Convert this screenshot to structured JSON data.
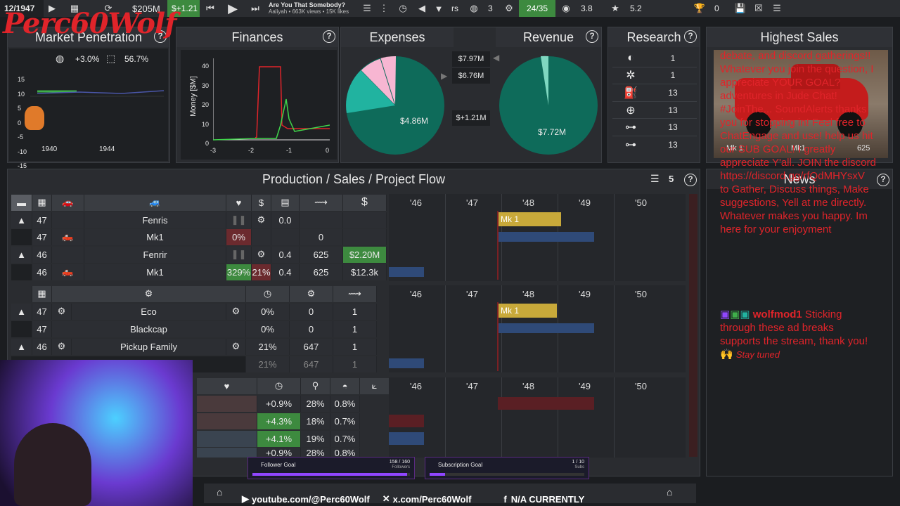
{
  "topbar": {
    "date": "12/1947",
    "money": "$205M",
    "delta": "$+1.21",
    "song_title": "Are You That Somebody?",
    "song_meta": "Aaliyah • 663K views • 15K likes",
    "rs_label": "rs",
    "regions": "3",
    "factories": "24/35",
    "rating": "3.8",
    "stars": "5.2",
    "trophies": "0"
  },
  "market": {
    "title": "Market Penetration",
    "global_pct": "+3.0%",
    "share_pct": "56.7%",
    "y_ticks": [
      "15",
      "10",
      "5",
      "0",
      "-5",
      "-10",
      "-15"
    ],
    "x_ticks": [
      "1940",
      "1944"
    ]
  },
  "finances": {
    "title": "Finances",
    "ylabel": "Money [$M]",
    "y_ticks": [
      "40",
      "30",
      "20",
      "10",
      "0"
    ],
    "x_ticks": [
      "-3",
      "-2",
      "-1",
      "0"
    ]
  },
  "expenses": {
    "title": "Expenses",
    "center_value": "$4.86M",
    "btn1": "$7.97M",
    "btn2": "$6.76M",
    "btn3": "$+1.21M"
  },
  "revenue": {
    "title": "Revenue",
    "center_value": "$7.72M"
  },
  "research": {
    "title": "Research",
    "rows": [
      {
        "icon": "turbo-icon",
        "value": "1"
      },
      {
        "icon": "wheel-icon",
        "value": "1"
      },
      {
        "icon": "fuel-icon",
        "value": "13"
      },
      {
        "icon": "steering-icon",
        "value": "13"
      },
      {
        "icon": "suspension-icon",
        "value": "13"
      },
      {
        "icon": "axle-icon",
        "value": "13"
      }
    ]
  },
  "highest_sales": {
    "title": "Highest Sales",
    "car1": "Mk 1",
    "car2": "Mk1",
    "value": "625"
  },
  "production": {
    "title": "Production / Sales / Project Flow",
    "count": "5",
    "years": [
      "'46",
      "'47",
      "'48",
      "'49",
      "'50"
    ],
    "rows1": [
      {
        "idx": "47",
        "name": "Fenris",
        "v1": "0.0",
        "sub": false
      },
      {
        "idx": "47",
        "name": "Mk1",
        "pct": "0%",
        "v2": "0",
        "sub": true
      },
      {
        "idx": "46",
        "name": "Fenrir",
        "v1": "0.4",
        "v2": "625",
        "money": "$2.20M",
        "sub": false
      },
      {
        "idx": "46",
        "name": "Mk1",
        "pct": "329%",
        "pct2": "21%",
        "v1": "0.4",
        "v2": "625",
        "money": "$12.3k",
        "sub": true
      }
    ],
    "rows2": [
      {
        "idx": "47",
        "name": "Eco",
        "pct": "0%",
        "v2": "0",
        "v3": "1"
      },
      {
        "idx": "47",
        "name": "Blackcap",
        "pct": "0%",
        "v2": "0",
        "v3": "1"
      },
      {
        "idx": "46",
        "name": "Pickup Family",
        "pct": "21%",
        "v2": "647",
        "v3": "1"
      },
      {
        "idx": "",
        "name": "",
        "pct": "21%",
        "v2": "647",
        "v3": "1"
      }
    ],
    "rows3": [
      {
        "a": "+0.9%",
        "b": "28%",
        "c": "0.8%"
      },
      {
        "a": "+4.3%",
        "b": "18%",
        "c": "0.7%"
      },
      {
        "a": "+4.1%",
        "b": "19%",
        "c": "0.7%"
      },
      {
        "a": "+0.9%",
        "b": "28%",
        "c": "0.8%"
      }
    ],
    "mk_label": "Mk 1"
  },
  "news": {
    "title": "News",
    "overlay_text": "debate, and discord gatherings!! Whatever you join the question, I appreciate YOUR GOAL? adventures in Jude Chat! #JoinThe... SoundAlerts thanks you for stopping in! Feel free to ChatEngage and use! help us hit our SUB GOAL! I greatly appreciate Y'all. JOIN the discord https://discord.gg/rfQdMHYsxV to Gather, Discuss things, Make suggestions, Yell at me directly. Whatever makes you happy. Im here for your enjoyment",
    "chat_user": "wolfmod1",
    "chat_text": "Sticking through these ad breaks supports the stream, thank you! 🙌",
    "chat_tail": "Stay tuned"
  },
  "stream": {
    "logo_text": "Perc60Wolf",
    "follower_goal": "Follower Goal",
    "follower_count": "158 / 160",
    "follower_unit": "Followers",
    "sub_goal": "Subscription Goal",
    "sub_count": "1 / 10",
    "sub_unit": "Subs",
    "youtube": "youtube.com/@Perc60Wolf",
    "x": "x.com/Perc60Wolf",
    "fb": "N/A CURRENTLY"
  },
  "colors": {
    "accent_green": "#3d8a3f",
    "expense_teal": "#0e6b5a",
    "highlight_red": "#e0242a",
    "gold": "#c8a93a",
    "blue": "#2f4a78"
  }
}
